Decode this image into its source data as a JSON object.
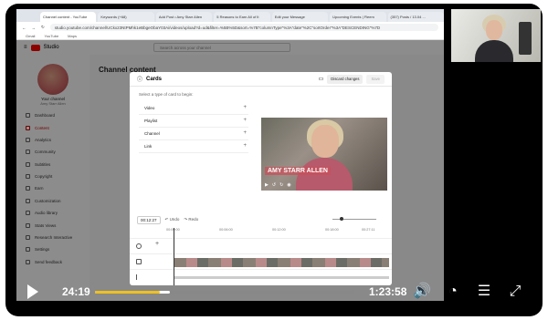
{
  "browser": {
    "tabs": [
      "Channel content - YouTube",
      "Keywords (+68)",
      "Add Post • Amy Starr Allen",
      "5 Reasons to Earn All of It",
      "Edit your Message",
      "Upcoming Events | Fleem",
      "(357) Posts / 13.04 ..."
    ],
    "url": "studio.youtube.com/channel/UCkx23NtPMhk1eBbgeObaY03Ai/videos/upload?d=ud&filter=%5B%5D&sort=%7B\"columnType\"%3A\"date\"%2C\"sortOrder\"%3A\"DESCENDING\"%7D",
    "bookmarks": [
      "Gmail",
      "YouTube",
      "Maps"
    ]
  },
  "studio": {
    "logo_text": "Studio",
    "search_placeholder": "Search across your channel",
    "channel_label": "Your channel",
    "channel_sub": "Amy Starr Allen",
    "page_title": "Channel content",
    "sidebar": [
      "Dashboard",
      "Content",
      "Analytics",
      "Community",
      "Subtitles",
      "Copyright",
      "Earn",
      "Customization",
      "Audio library",
      "Stats Views",
      "Research Interactive",
      "Settings",
      "Send feedback"
    ]
  },
  "modal": {
    "title": "Cards",
    "discard_label": "Discard changes",
    "save_label": "Save",
    "prompt": "Select a type of card to begin:",
    "card_types": [
      "Video",
      "Playlist",
      "Channel",
      "Link"
    ],
    "video_name": "AMY STARR ALLEN",
    "timecode": "00:12:27",
    "undo_label": "Undo",
    "redo_label": "Redo",
    "ruler": [
      "00:00:00",
      "00:06:00",
      "00:12:00",
      "00:18:00",
      "00:27:11"
    ]
  },
  "player": {
    "current_time": "24:19",
    "duration": "1:23:58",
    "progress_fraction": 0.29,
    "buffered_fraction": 0.25
  },
  "colors": {
    "youtube_red": "#ff0000",
    "progress_yellow": "#f0c020"
  }
}
